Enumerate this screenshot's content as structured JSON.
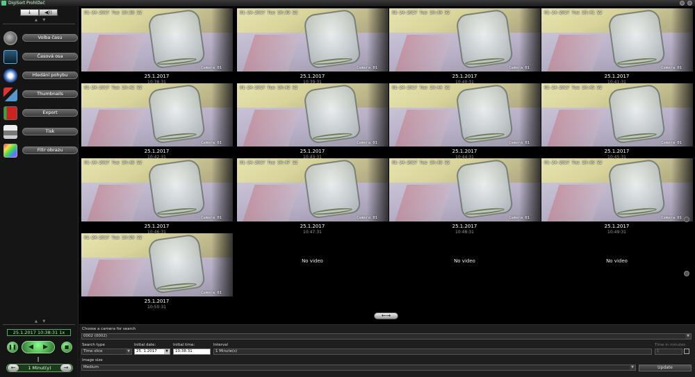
{
  "window": {
    "title": "DigiSort Prohlížeč"
  },
  "sidebar": {
    "toolbar": {
      "btn1": "↓",
      "btn2": "◀))"
    },
    "scroll_up": "▲ ▼",
    "scroll_down": "▲ ▼",
    "menu": [
      {
        "label": "Volba času",
        "icon": "clock-icon"
      },
      {
        "label": "Časová osa",
        "icon": "film-strip-icon"
      },
      {
        "label": "Hledání pohybu",
        "icon": "motion-search-icon"
      },
      {
        "label": "Thumbnails",
        "icon": "tools-icon"
      },
      {
        "label": "Export",
        "icon": "export-book-icon"
      },
      {
        "label": "Tisk",
        "icon": "printer-icon"
      },
      {
        "label": "Filtr obrazu",
        "icon": "image-filter-icon"
      }
    ],
    "playback": {
      "current": "25.1.2017 10:38:31 1x",
      "interval_value": "1 Minut(y)",
      "prev_arrow": "←",
      "next_arrow": "→"
    }
  },
  "grid": {
    "cells": [
      {
        "osd": "01-24-2017 Tue 10:38 52",
        "camera": "Camera 01",
        "date": "25.1.2017",
        "time": "10:38:31"
      },
      {
        "osd": "01-24-2017 Tue 10:39 52",
        "camera": "Camera 01",
        "date": "25.1.2017",
        "time": "10:39:31"
      },
      {
        "osd": "01-24-2017 Tue 10:40 52",
        "camera": "Camera 01",
        "date": "25.1.2017",
        "time": "10:40:31"
      },
      {
        "osd": "01-24-2017 Tue 10:41 52",
        "camera": "Camera 01",
        "date": "25.1.2017",
        "time": "10:41:31"
      },
      {
        "osd": "01-24-2017 Tue 10:42 52",
        "camera": "Camera 01",
        "date": "25.1.2017",
        "time": "10:42:31"
      },
      {
        "osd": "01-24-2017 Tue 10:43 52",
        "camera": "Camera 01",
        "date": "25.1.2017",
        "time": "10:43:31"
      },
      {
        "osd": "01-24-2017 Tue 10:44 52",
        "camera": "Camera 01",
        "date": "25.1.2017",
        "time": "10:44:31"
      },
      {
        "osd": "01-24-2017 Tue 10:45 52",
        "camera": "Camera 01",
        "date": "25.1.2017",
        "time": "10:45:31"
      },
      {
        "osd": "01-24-2017 Tue 10:46 52",
        "camera": "Camera 01",
        "date": "25.1.2017",
        "time": "10:46:31"
      },
      {
        "osd": "01-24-2017 Tue 10:47 52",
        "camera": "Camera 01",
        "date": "25.1.2017",
        "time": "10:47:31"
      },
      {
        "osd": "01-24-2017 Tue 10:48 52",
        "camera": "Camera 01",
        "date": "25.1.2017",
        "time": "10:48:31"
      },
      {
        "osd": "01-24-2017 Tue 10:49 52",
        "camera": "Camera 01",
        "date": "25.1.2017",
        "time": "10:49:31"
      },
      {
        "osd": "01-24-2017 Tue 10:50 52",
        "camera": "Camera 01",
        "date": "25.1.2017",
        "time": "10:50:31"
      }
    ],
    "no_video_text": "No video",
    "pager_label": "←→"
  },
  "search": {
    "camera_label": "Choose a camera for search",
    "camera_value": "0002 (0002)",
    "search_type_label": "Search type",
    "search_type_value": "Time slice",
    "initial_date_label": "Initial date:",
    "initial_date_value": "25. 1.2017",
    "initial_time_label": "Initial time:",
    "initial_time_value": "10:38:31",
    "interval_label": "Interval",
    "interval_value": "1 Minute(s)",
    "time_in_minutes_label": "Time in minutes",
    "time_in_minutes_value": "1",
    "image_size_label": "Image size",
    "image_size_value": "Medium",
    "update_label": "Update"
  }
}
